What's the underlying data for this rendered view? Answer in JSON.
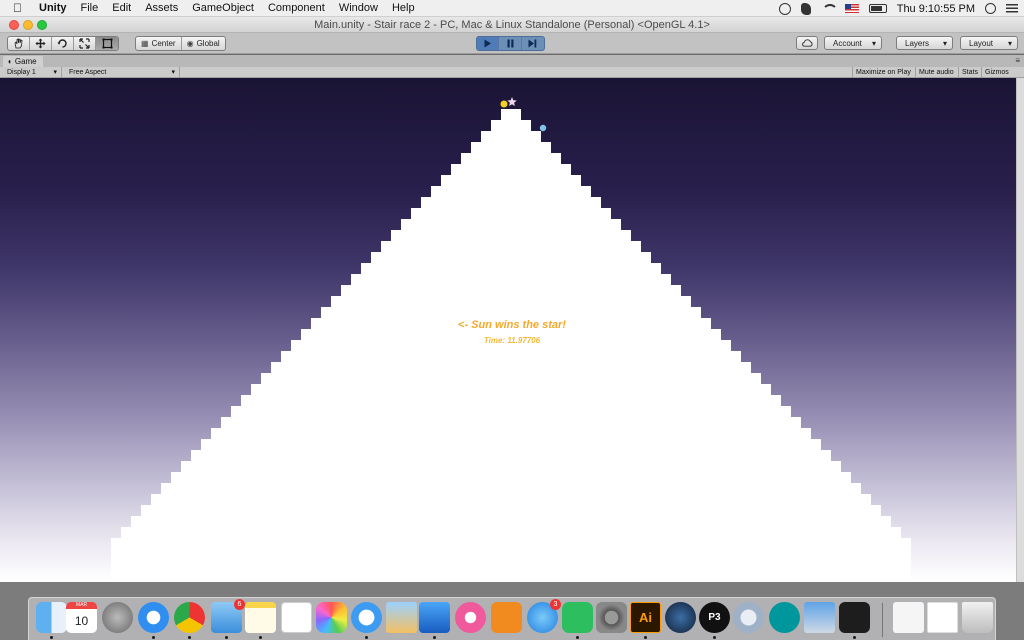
{
  "menubar": {
    "app_name": "Unity",
    "items": [
      "File",
      "Edit",
      "Assets",
      "GameObject",
      "Component",
      "Window",
      "Help"
    ],
    "clock": "Thu 9:10:55 PM"
  },
  "window": {
    "title": "Main.unity - Stair race 2 - PC, Mac & Linux Standalone (Personal) <OpenGL 4.1>"
  },
  "toolbar": {
    "transform_tools": [
      "hand-tool",
      "move-tool",
      "rotate-tool",
      "scale-tool",
      "rect-tool"
    ],
    "pivot_label": "Center",
    "space_label": "Global",
    "account_label": "Account",
    "layers_label": "Layers",
    "layout_label": "Layout"
  },
  "game_panel": {
    "tab_label": "Game",
    "display_label": "Display 1",
    "aspect_label": "Free Aspect",
    "maximize_label": "Maximize on Play",
    "mute_label": "Mute audio",
    "stats_label": "Stats",
    "gizmos_label": "Gizmos"
  },
  "game": {
    "win_message": "<- Sun wins the star!",
    "time_label": "Time: 11.97706",
    "sky_colors": {
      "top": "#1a1434",
      "bottom": "#ffffff"
    },
    "text_color": "#f6a82a",
    "sun_color": "#f5d21e",
    "star_color": "#f3d9e9",
    "player_color": "#7fc3e6"
  },
  "dock": {
    "apps": [
      {
        "name": "finder-icon"
      },
      {
        "name": "calendar-icon",
        "label": "10",
        "month": "MAR"
      },
      {
        "name": "launchpad-icon"
      },
      {
        "name": "safari-icon"
      },
      {
        "name": "chrome-icon"
      },
      {
        "name": "mail-icon",
        "badge": "6"
      },
      {
        "name": "notes-icon"
      },
      {
        "name": "reminders-icon"
      },
      {
        "name": "photos-icon"
      },
      {
        "name": "messages-icon"
      },
      {
        "name": "preview-icon"
      },
      {
        "name": "keynote-icon"
      },
      {
        "name": "itunes-icon"
      },
      {
        "name": "ibooks-icon"
      },
      {
        "name": "app-store-icon",
        "badge": "3"
      },
      {
        "name": "evernote-icon"
      },
      {
        "name": "system-preferences-icon"
      },
      {
        "name": "illustrator-icon",
        "label": "Ai"
      },
      {
        "name": "steam-icon"
      },
      {
        "name": "processing-icon",
        "label": "P3"
      },
      {
        "name": "disk-utility-icon"
      },
      {
        "name": "arduino-icon"
      },
      {
        "name": "image-capture-icon"
      },
      {
        "name": "unity-icon"
      },
      {
        "name": "downloads-stack-icon"
      },
      {
        "name": "documents-stack-icon"
      },
      {
        "name": "trash-icon"
      }
    ]
  }
}
